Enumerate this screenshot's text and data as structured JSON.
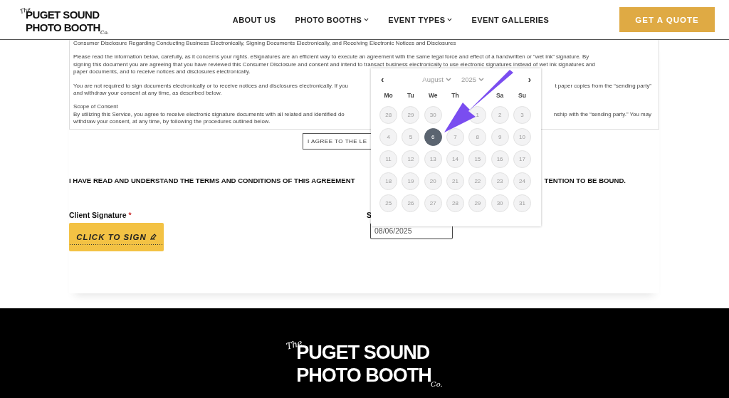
{
  "header": {
    "logo": {
      "the": "The",
      "line1": "PUGET SOUND",
      "line2": "PHOTO BOOTH",
      "co": "Co."
    },
    "nav": [
      {
        "label": "ABOUT US",
        "has_menu": false
      },
      {
        "label": "PHOTO BOOTHS",
        "has_menu": true
      },
      {
        "label": "EVENT TYPES",
        "has_menu": true
      },
      {
        "label": "EVENT GALLERIES",
        "has_menu": false
      }
    ],
    "cta": "GET A QUOTE"
  },
  "disclosure": {
    "paragraphs": [
      {
        "lines": [
          {
            "left": "Consumer Disclosure Regarding Conducting Business Electronically, Signing Documents Electronically, and Receiving Electronic Notices and Disclosures"
          }
        ]
      },
      {
        "lines": [
          {
            "left": "Please read the information below, carefully, as it concerns your rights. eSignatures are an efficient way to execute an agreement with the same legal force and effect of a handwritten or “wet ink” signature. By"
          },
          {
            "left": "signing this document you are agreeing that you have reviewed this Consumer Disclosure and consent and intend to transact business electronically to use electronic signatures instead of wet ink signatures and"
          },
          {
            "left": "paper documents, and to receive notices and disclosures electronically."
          }
        ]
      },
      {
        "lines": [
          {
            "left": "You are not required to sign documents electronically or to receive notices and disclosures electronically. If you",
            "right": "t paper copies from the “sending party”"
          },
          {
            "left": "and withdraw your consent at any time, as described below."
          }
        ]
      },
      {
        "lines": [
          {
            "left": "Scope of Consent"
          },
          {
            "left": "By utilizing this Service, you agree to receive electronic signature documents with all related and identified do",
            "right": "nship with the “sending party.” You may"
          },
          {
            "left": "withdraw your consent, at any time, by following the procedures outlined below."
          }
        ]
      }
    ]
  },
  "agree_button": "I AGREE TO THE LE",
  "statement": {
    "left": "I HAVE READ AND UNDERSTAND THE TERMS AND CONDITIONS OF THIS AGREEMENT",
    "right": "TENTION TO BE BOUND."
  },
  "signature": {
    "label": "Client Signature",
    "required_mark": "*",
    "button": "CLICK TO SIGN"
  },
  "date_field": {
    "label": "S",
    "value": "08/06/2025"
  },
  "datepicker": {
    "prev": "‹",
    "next": "›",
    "month": "August",
    "year": "2025",
    "weekdays": {
      "left": [
        "Mo",
        "Tu",
        "We",
        "Th"
      ],
      "right": [
        "Sa",
        "Su"
      ]
    },
    "first_week": {
      "left": [
        {
          "day": "28",
          "selected": false
        },
        {
          "day": "29",
          "selected": false
        },
        {
          "day": "30",
          "selected": false
        }
      ],
      "right": [
        {
          "day": "1",
          "selected": false
        },
        {
          "day": "2",
          "selected": false
        },
        {
          "day": "3",
          "selected": false
        }
      ]
    },
    "weeks": [
      [
        {
          "day": "4",
          "selected": false
        },
        {
          "day": "5",
          "selected": false
        },
        {
          "day": "6",
          "selected": true
        },
        {
          "day": "7",
          "selected": false
        },
        {
          "day": "8",
          "selected": false
        },
        {
          "day": "9",
          "selected": false
        },
        {
          "day": "10",
          "selected": false
        }
      ],
      [
        {
          "day": "11",
          "selected": false
        },
        {
          "day": "12",
          "selected": false
        },
        {
          "day": "13",
          "selected": false
        },
        {
          "day": "14",
          "selected": false
        },
        {
          "day": "15",
          "selected": false
        },
        {
          "day": "16",
          "selected": false
        },
        {
          "day": "17",
          "selected": false
        }
      ],
      [
        {
          "day": "18",
          "selected": false
        },
        {
          "day": "19",
          "selected": false
        },
        {
          "day": "20",
          "selected": false
        },
        {
          "day": "21",
          "selected": false
        },
        {
          "day": "22",
          "selected": false
        },
        {
          "day": "23",
          "selected": false
        },
        {
          "day": "24",
          "selected": false
        }
      ],
      [
        {
          "day": "25",
          "selected": false
        },
        {
          "day": "26",
          "selected": false
        },
        {
          "day": "27",
          "selected": false
        },
        {
          "day": "28",
          "selected": false
        },
        {
          "day": "29",
          "selected": false
        },
        {
          "day": "30",
          "selected": false
        },
        {
          "day": "31",
          "selected": false
        }
      ]
    ]
  },
  "footer": {
    "logo": {
      "the": "The",
      "line1": "PUGET SOUND",
      "line2": "PHOTO BOOTH",
      "co": "Co."
    }
  }
}
